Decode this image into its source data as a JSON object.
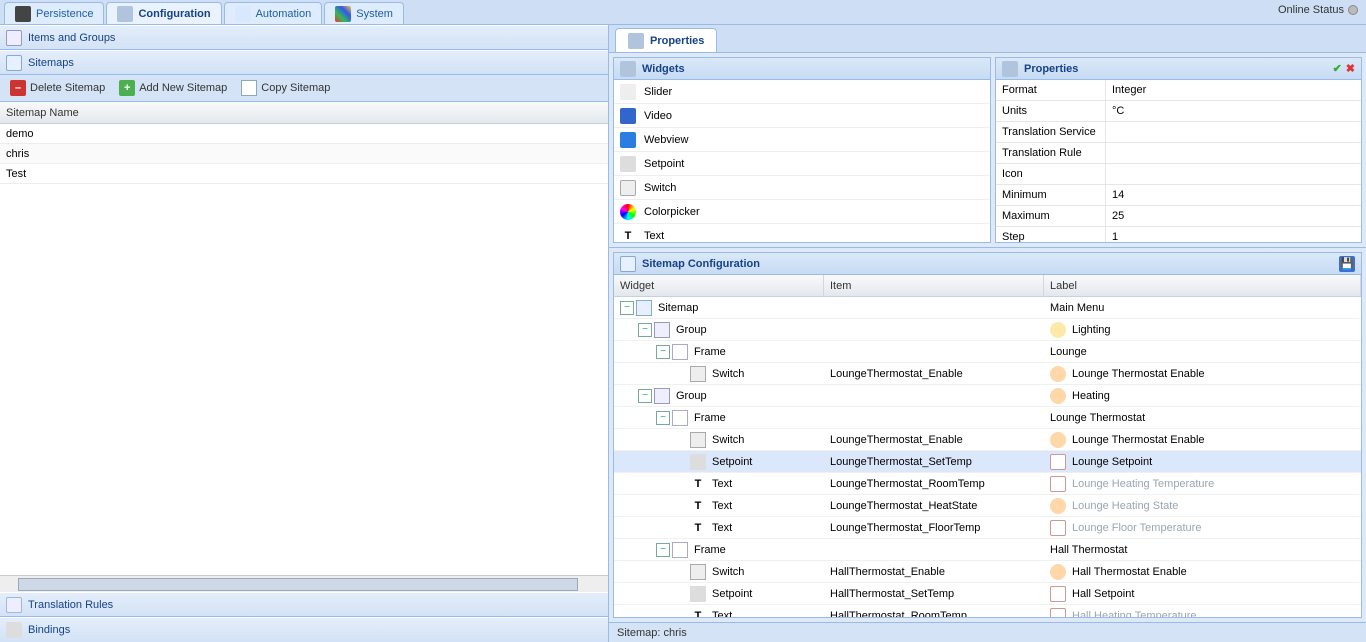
{
  "top": {
    "tabs": [
      {
        "label": "Persistence",
        "icon": "db"
      },
      {
        "label": "Configuration",
        "icon": "gear",
        "active": true
      },
      {
        "label": "Automation",
        "icon": "auto"
      },
      {
        "label": "System",
        "icon": "sys"
      }
    ],
    "status": "Online Status"
  },
  "left": {
    "items_groups": "Items and Groups",
    "sitemaps": "Sitemaps",
    "toolbar": {
      "delete": "Delete Sitemap",
      "add": "Add New Sitemap",
      "copy": "Copy Sitemap"
    },
    "grid_header": "Sitemap Name",
    "rows": [
      "demo",
      "chris",
      "Test"
    ],
    "translation": "Translation Rules",
    "bindings": "Bindings"
  },
  "right": {
    "tab": "Properties",
    "widgets_title": "Widgets",
    "widgets": [
      {
        "label": "Slider",
        "icon": "slider"
      },
      {
        "label": "Video",
        "icon": "video"
      },
      {
        "label": "Webview",
        "icon": "globe"
      },
      {
        "label": "Setpoint",
        "icon": "setp"
      },
      {
        "label": "Switch",
        "icon": "switch"
      },
      {
        "label": "Colorpicker",
        "icon": "color"
      },
      {
        "label": "Text",
        "icon": "text",
        "glyph": "T"
      }
    ],
    "props_title": "Properties",
    "props": [
      {
        "k": "Format",
        "v": "Integer"
      },
      {
        "k": "Units",
        "v": "°C"
      },
      {
        "k": "Translation Service",
        "v": ""
      },
      {
        "k": "Translation Rule",
        "v": ""
      },
      {
        "k": "Icon",
        "v": ""
      },
      {
        "k": "Minimum",
        "v": "14"
      },
      {
        "k": "Maximum",
        "v": "25"
      },
      {
        "k": "Step",
        "v": "1"
      }
    ],
    "config_title": "Sitemap Configuration",
    "cols": {
      "widget": "Widget",
      "item": "Item",
      "label": "Label"
    },
    "tree": [
      {
        "depth": 0,
        "toggle": "minus",
        "icon": "sitemap",
        "w": "Sitemap",
        "i": "",
        "l": "Main Menu"
      },
      {
        "depth": 1,
        "toggle": "minus",
        "icon": "group",
        "w": "Group",
        "i": "",
        "l": "Lighting",
        "licon": "light"
      },
      {
        "depth": 2,
        "toggle": "minus",
        "icon": "frame",
        "w": "Frame",
        "i": "",
        "l": "Lounge"
      },
      {
        "depth": 3,
        "toggle": "",
        "icon": "switch",
        "w": "Switch",
        "i": "LoungeThermostat_Enable",
        "l": "Lounge Thermostat Enable",
        "licon": "heat"
      },
      {
        "depth": 1,
        "toggle": "minus",
        "icon": "group",
        "w": "Group",
        "i": "",
        "l": "Heating",
        "licon": "heat"
      },
      {
        "depth": 2,
        "toggle": "minus",
        "icon": "frame",
        "w": "Frame",
        "i": "",
        "l": "Lounge Thermostat"
      },
      {
        "depth": 3,
        "toggle": "",
        "icon": "switch",
        "w": "Switch",
        "i": "LoungeThermostat_Enable",
        "l": "Lounge Thermostat Enable",
        "licon": "heat"
      },
      {
        "depth": 3,
        "toggle": "",
        "icon": "setp",
        "w": "Setpoint",
        "i": "LoungeThermostat_SetTemp",
        "l": "Lounge Setpoint",
        "licon": "therm",
        "selected": true
      },
      {
        "depth": 3,
        "toggle": "",
        "icon": "text",
        "glyph": "T",
        "w": "Text",
        "i": "LoungeThermostat_RoomTemp",
        "l": "Lounge Heating Temperature",
        "licon": "therm",
        "dim": true
      },
      {
        "depth": 3,
        "toggle": "",
        "icon": "text",
        "glyph": "T",
        "w": "Text",
        "i": "LoungeThermostat_HeatState",
        "l": "Lounge Heating State",
        "licon": "heat",
        "dim": true
      },
      {
        "depth": 3,
        "toggle": "",
        "icon": "text",
        "glyph": "T",
        "w": "Text",
        "i": "LoungeThermostat_FloorTemp",
        "l": "Lounge Floor Temperature",
        "licon": "therm",
        "dim": true
      },
      {
        "depth": 2,
        "toggle": "minus",
        "icon": "frame",
        "w": "Frame",
        "i": "",
        "l": "Hall Thermostat"
      },
      {
        "depth": 3,
        "toggle": "",
        "icon": "switch",
        "w": "Switch",
        "i": "HallThermostat_Enable",
        "l": "Hall Thermostat Enable",
        "licon": "heat"
      },
      {
        "depth": 3,
        "toggle": "",
        "icon": "setp",
        "w": "Setpoint",
        "i": "HallThermostat_SetTemp",
        "l": "Hall Setpoint",
        "licon": "therm"
      },
      {
        "depth": 3,
        "toggle": "",
        "icon": "text",
        "glyph": "T",
        "w": "Text",
        "i": "HallThermostat_RoomTemp",
        "l": "Hall Heating Temperature",
        "licon": "therm",
        "dim": true
      }
    ],
    "statusbar": "Sitemap: chris"
  }
}
